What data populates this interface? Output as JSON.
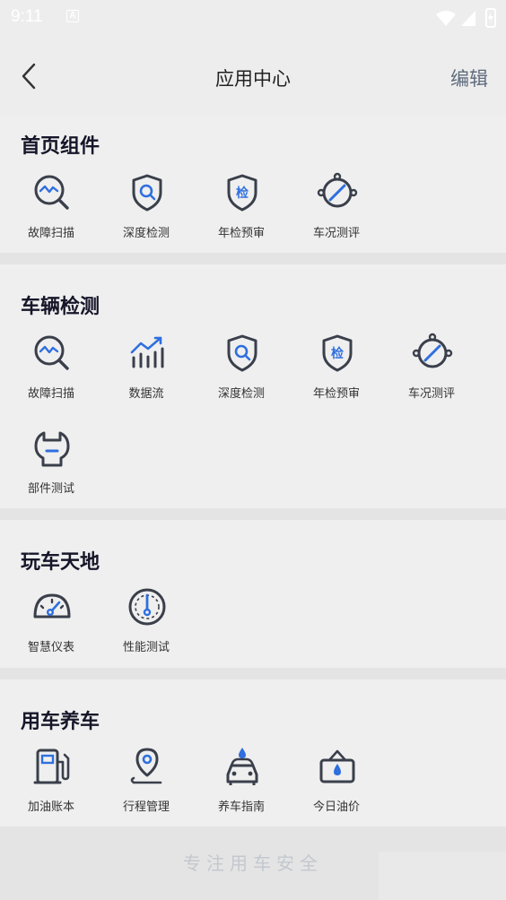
{
  "status_bar": {
    "time": "9:11",
    "a_icon": "A"
  },
  "header": {
    "title": "应用中心",
    "edit_label": "编辑"
  },
  "sections": [
    {
      "title": "首页组件",
      "items": [
        {
          "label": "故障扫描",
          "icon": "fault-scan-icon"
        },
        {
          "label": "深度检测",
          "icon": "deep-detect-icon"
        },
        {
          "label": "年检预审",
          "icon": "annual-check-icon"
        },
        {
          "label": "车况测评",
          "icon": "condition-eval-icon"
        }
      ]
    },
    {
      "title": "车辆检测",
      "items": [
        {
          "label": "故障扫描",
          "icon": "fault-scan-icon"
        },
        {
          "label": "数据流",
          "icon": "data-stream-icon"
        },
        {
          "label": "深度检测",
          "icon": "deep-detect-icon"
        },
        {
          "label": "年检预审",
          "icon": "annual-check-icon"
        },
        {
          "label": "车况测评",
          "icon": "condition-eval-icon"
        },
        {
          "label": "部件测试",
          "icon": "part-test-icon"
        }
      ]
    },
    {
      "title": "玩车天地",
      "items": [
        {
          "label": "智慧仪表",
          "icon": "smart-gauge-icon"
        },
        {
          "label": "性能测试",
          "icon": "performance-test-icon"
        }
      ]
    },
    {
      "title": "用车养车",
      "items": [
        {
          "label": "加油账本",
          "icon": "fuel-ledger-icon"
        },
        {
          "label": "行程管理",
          "icon": "trip-manage-icon"
        },
        {
          "label": "养车指南",
          "icon": "car-care-icon"
        },
        {
          "label": "今日油价",
          "icon": "oil-price-icon"
        }
      ]
    }
  ],
  "footer": {
    "slogan": "专注用车安全"
  },
  "colors": {
    "icon_dark": "#3a3f4b",
    "icon_accent": "#2f6fde",
    "background": "#ededed",
    "divider": "#e4e4e4"
  }
}
